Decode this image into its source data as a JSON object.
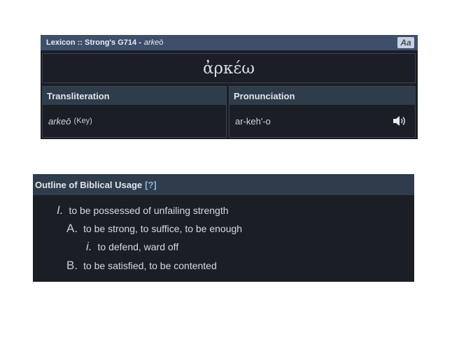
{
  "lexicon": {
    "header_prefix": "Lexicon :: Strong's G714 -",
    "header_word": "arkeō",
    "font_toggle": "Aa",
    "greek_word": "ἀρκέω",
    "transliteration": {
      "heading": "Transliteration",
      "value": "arkeō",
      "key_link": "(Key)"
    },
    "pronunciation": {
      "heading": "Pronunciation",
      "value": "ar-keh'-o",
      "audio_icon": "speaker-icon"
    }
  },
  "outline": {
    "heading": "Outline of Biblical Usage",
    "help": "[?]",
    "items": [
      {
        "marker": "I.",
        "text": "to be possessed of unfailing strength"
      },
      {
        "marker": "A.",
        "text": "to be strong, to suffice, to be enough"
      },
      {
        "marker": "i.",
        "text": "to defend, ward off"
      },
      {
        "marker": "B.",
        "text": "to be satisfied, to be contented"
      }
    ]
  },
  "colors": {
    "panel_bg": "#1b1e25",
    "header_bar": "#3d4f6b",
    "cell_header": "#2f3c4b",
    "text": "#d6dbe1"
  }
}
